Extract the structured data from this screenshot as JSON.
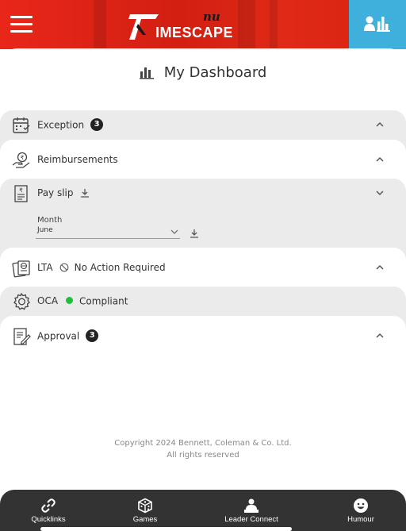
{
  "header": {
    "logo_text": "IMESCAPE",
    "logo_script": "nu"
  },
  "page_title": "My Dashboard",
  "sections": {
    "exception": {
      "label": "Exception",
      "count": "3"
    },
    "reimbursements": {
      "label": "Reimbursements"
    },
    "payslip": {
      "label": "Pay slip",
      "month_label": "Month",
      "month_value": "June"
    },
    "lta": {
      "label": "LTA",
      "status": "No Action Required"
    },
    "oca": {
      "label": "OCA",
      "status": "Compliant",
      "status_color": "#1fbf3a"
    },
    "approval": {
      "label": "Approval",
      "count": "3"
    }
  },
  "footer": {
    "copyright_line1": "Copyright 2024 Bennett, Coleman & Co. Ltd.",
    "copyright_line2": "All rights reserved"
  },
  "bottom_nav": {
    "items": [
      {
        "label": "Quicklinks",
        "icon": "link-icon"
      },
      {
        "label": "Games",
        "icon": "dice-icon"
      },
      {
        "label": "Leader Connect",
        "icon": "leader-icon"
      },
      {
        "label": "Humour",
        "icon": "smiley-icon"
      }
    ]
  },
  "colors": {
    "header_red": "#e02a17",
    "dashboard_button": "#3fb0dc",
    "bottom_nav": "#333333",
    "row_grey": "#ebebeb"
  }
}
